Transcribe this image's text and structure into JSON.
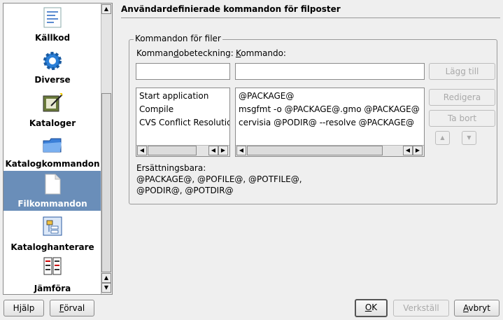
{
  "sidebar": {
    "items": [
      {
        "label": "Källkod",
        "icon": "source-code-icon"
      },
      {
        "label": "Diverse",
        "icon": "gear-icon"
      },
      {
        "label": "Kataloger",
        "icon": "catalog-wand-icon"
      },
      {
        "label": "Katalogkommandon",
        "icon": "folder-icon"
      },
      {
        "label": "Filkommandon",
        "icon": "file-icon",
        "selected": true
      },
      {
        "label": "Kataloghanterare",
        "icon": "catalog-manager-icon"
      },
      {
        "label": "Jämföra",
        "icon": "compare-icon"
      }
    ]
  },
  "page": {
    "title": "Användardefinierade kommandon för filposter",
    "group_title": "Kommandon för filer",
    "label_description": "Kommandobeteckning:",
    "label_command": "Kommando:",
    "description_value": "",
    "command_value": "",
    "add_button": "Lägg till",
    "edit_button": "Redigera",
    "remove_button": "Ta bort",
    "descriptions": [
      "Start application",
      "Compile",
      "CVS Conflict Resolution"
    ],
    "commands": [
      "@PACKAGE@",
      "msgfmt -o @PACKAGE@.gmo @PACKAGE@",
      "cervisia @PODIR@ --resolve @PACKAGE@"
    ],
    "replaceables_label": "Ersättningsbara:",
    "replaceables_line1": "@PACKAGE@, @POFILE@, @POTFILE@,",
    "replaceables_line2": "@PODIR@, @POTDIR@"
  },
  "footer": {
    "help": "Hjälp",
    "defaults": "Förval",
    "ok": "OK",
    "apply": "Verkställ",
    "cancel": "Avbryt"
  }
}
